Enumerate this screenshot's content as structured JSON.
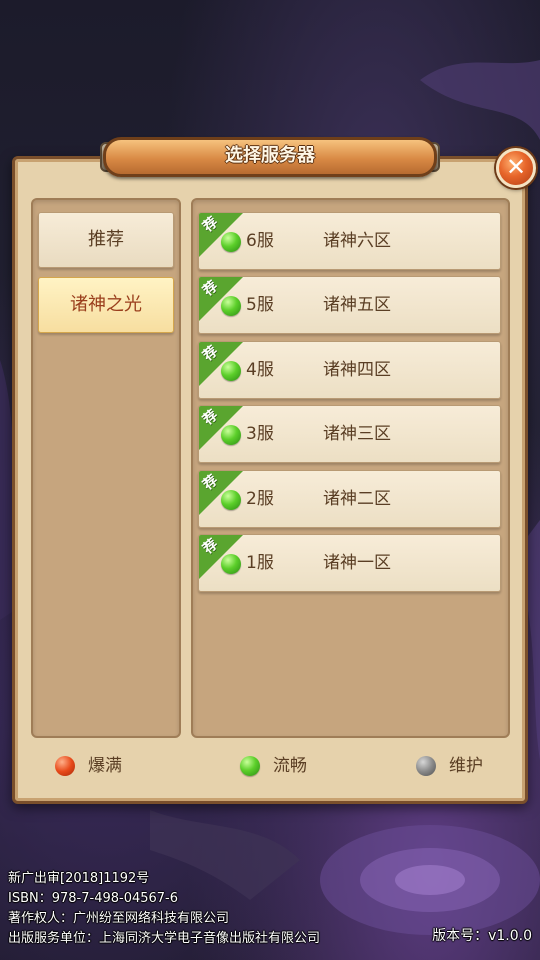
{
  "dialog": {
    "title": "选择服务器",
    "close_symbol": "✕"
  },
  "categories": [
    {
      "label": "推荐",
      "active": false
    },
    {
      "label": "诸神之光",
      "active": true
    }
  ],
  "recommend_tag": "荐",
  "servers": [
    {
      "number": "6服",
      "name": "诸神六区",
      "status": "流畅",
      "recommended": true
    },
    {
      "number": "5服",
      "name": "诸神五区",
      "status": "流畅",
      "recommended": true
    },
    {
      "number": "4服",
      "name": "诸神四区",
      "status": "流畅",
      "recommended": true
    },
    {
      "number": "3服",
      "name": "诸神三区",
      "status": "流畅",
      "recommended": true
    },
    {
      "number": "2服",
      "name": "诸神二区",
      "status": "流畅",
      "recommended": true
    },
    {
      "number": "1服",
      "name": "诸神一区",
      "status": "流畅",
      "recommended": true
    }
  ],
  "legend": [
    {
      "label": "爆满",
      "color": "#e84a1a",
      "icon": "red-status-dot"
    },
    {
      "label": "流畅",
      "color": "#5ccf2a",
      "icon": "green-status-dot"
    },
    {
      "label": "维护",
      "color": "#8a8a8a",
      "icon": "gray-status-dot"
    }
  ],
  "footer": {
    "line1": "新广出审[2018]1192号",
    "line2": "ISBN：978-7-498-04567-6",
    "line3": "著作权人：广州纷至网络科技有限公司",
    "line4": "出版服务单位：上海同济大学电子音像出版社有限公司",
    "version": "版本号：v1.0.0"
  }
}
